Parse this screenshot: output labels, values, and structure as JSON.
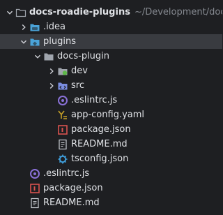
{
  "project": {
    "name": "docs-roadie-plugins",
    "path": "~/Development/docs-r"
  },
  "items": [
    {
      "label": ".idea"
    },
    {
      "label": "plugins"
    },
    {
      "label": "docs-plugin"
    },
    {
      "label": "dev"
    },
    {
      "label": "src"
    },
    {
      "label": ".eslintrc.js"
    },
    {
      "label": "app-config.yaml"
    },
    {
      "label": "package.json"
    },
    {
      "label": "README.md"
    },
    {
      "label": "tsconfig.json"
    },
    {
      "label": ".eslintrc.js"
    },
    {
      "label": "package.json"
    },
    {
      "label": "README.md"
    }
  ],
  "icons": {
    "folder": "#a0a5ad",
    "module_folder": "#4aa3d8",
    "source_folder": "#7a8de0",
    "dev_dot": "#5fb84a",
    "eslint": "#8a71d8",
    "yaml": "#c9a227",
    "npm": "#d9534f",
    "tsconfig": "#3f9fdc",
    "text": "#c9cdd3"
  },
  "colors": {
    "background": "#1e1f22",
    "selection": "#393b40",
    "text": "#dfe1e5",
    "muted_text": "#868a91"
  }
}
